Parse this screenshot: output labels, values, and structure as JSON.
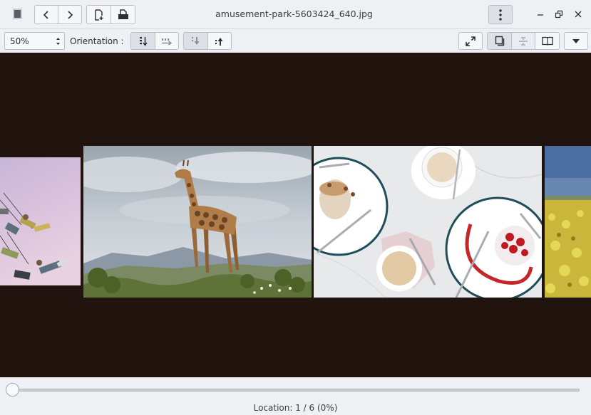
{
  "window": {
    "title": "amusement-park-5603424_640.jpg"
  },
  "toolbar": {
    "zoom_value": "50%",
    "orientation_label": "Orientation :"
  },
  "status": {
    "location": "Location: 1 / 6 (0%)"
  },
  "slider": {
    "position_fraction": 0.0
  },
  "icons": {
    "app": "document-viewer-icon",
    "back": "chevron-left-icon",
    "forward": "chevron-right-icon",
    "new": "new-document-icon",
    "open": "open-folder-icon",
    "menu": "kebab-menu-icon",
    "minimize": "minimize-icon",
    "restore": "restore-icon",
    "close": "close-icon"
  },
  "colors": {
    "viewer_background": "#21140e",
    "toolbar_background": "#eef0f4",
    "button_border": "#b9bec8"
  }
}
